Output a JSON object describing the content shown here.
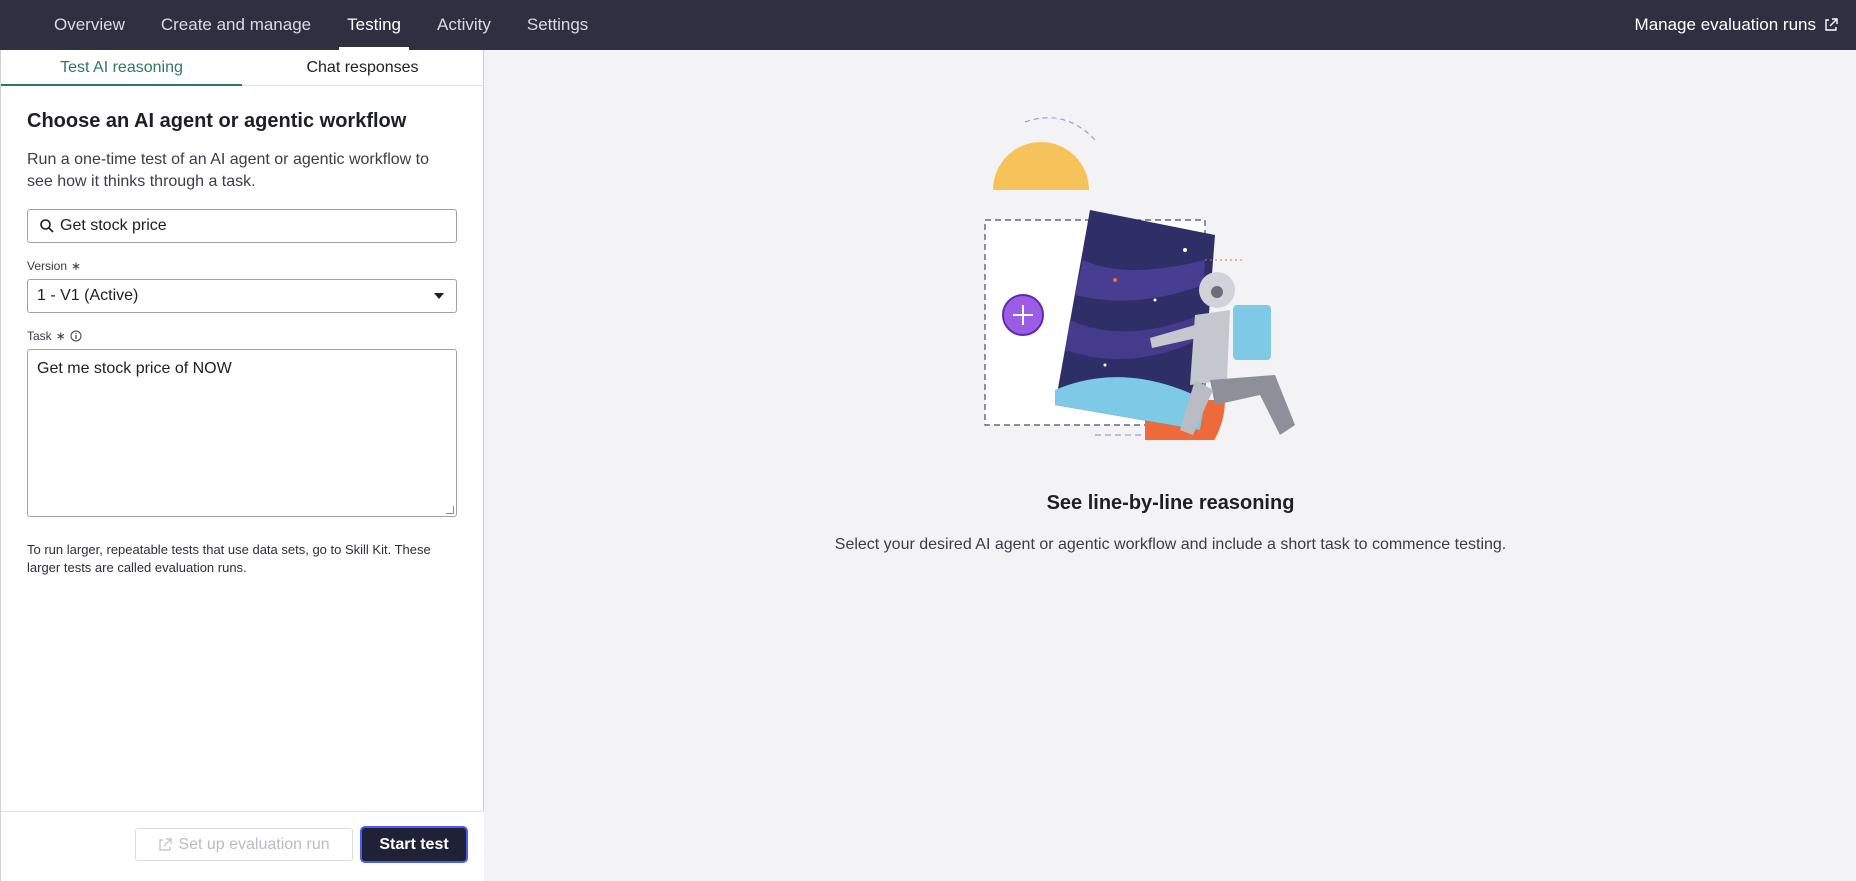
{
  "topnav": {
    "tabs": [
      {
        "label": "Overview"
      },
      {
        "label": "Create and manage"
      },
      {
        "label": "Testing"
      },
      {
        "label": "Activity"
      },
      {
        "label": "Settings"
      }
    ],
    "active_tab": "Testing",
    "right_link": "Manage evaluation runs"
  },
  "left": {
    "subtabs": [
      {
        "label": "Test AI reasoning"
      },
      {
        "label": "Chat responses"
      }
    ],
    "heading": "Choose an AI agent or agentic workflow",
    "description": "Run a one-time test of an AI agent or agentic workflow to see how it thinks through a task.",
    "search_value": "Get stock price",
    "version_label": "Version",
    "version_value": "1 - V1 (Active)",
    "task_label": "Task",
    "required_mark": "∗",
    "task_value": "Get me stock price of NOW",
    "hint": "To run larger, repeatable tests that use data sets, go to Skill Kit. These larger tests are called evaluation runs.",
    "eval_button": "Set up evaluation run",
    "start_button": "Start test"
  },
  "right": {
    "title": "See line-by-line reasoning",
    "description": "Select your desired AI agent or agentic workflow and include a short task to commence testing."
  },
  "colors": {
    "nav_bg": "#2e3042",
    "accent_green": "#2f7a5b",
    "primary_button": "#1f2237",
    "focus_ring": "#4b5cf0"
  }
}
